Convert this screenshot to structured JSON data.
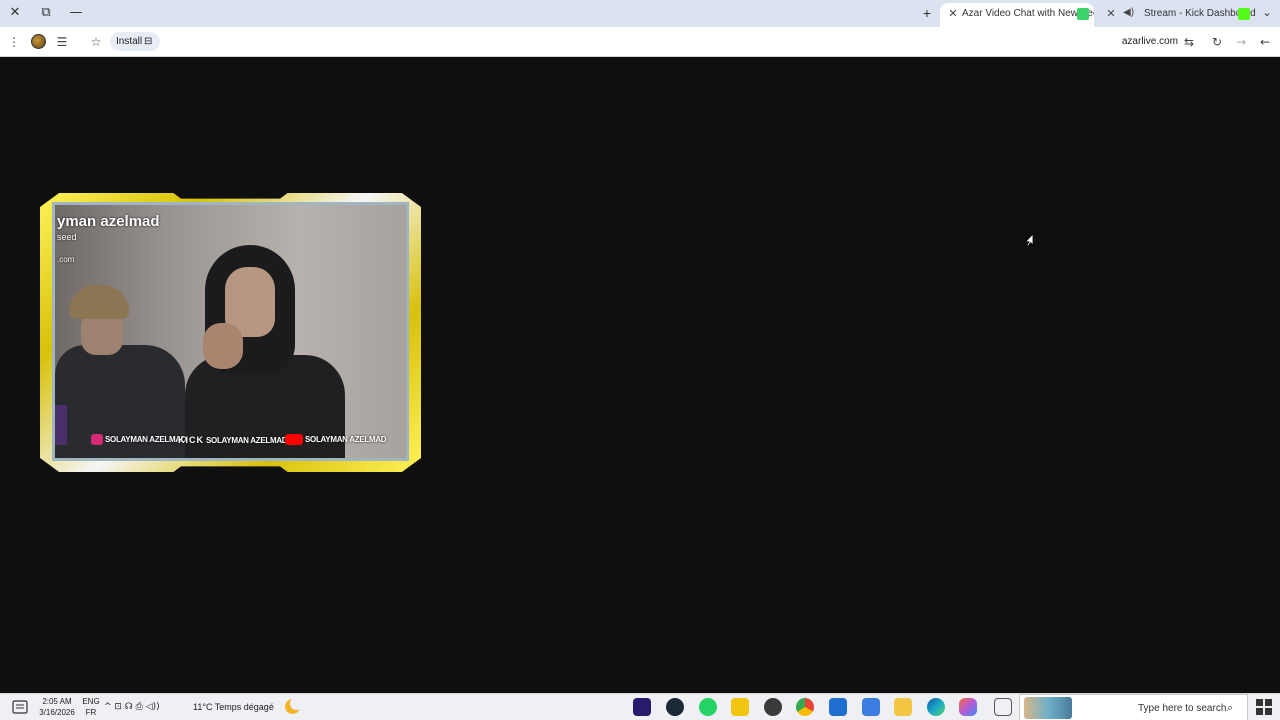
{
  "window": {
    "close_glyph": "✕",
    "restore_glyph": "⧉",
    "minimize_glyph": "—"
  },
  "tabs": {
    "new_tab_glyph": "+",
    "menu_glyph": "⌄",
    "items": [
      {
        "title": "Azar Video Chat with New Peo",
        "close": "✕",
        "favicon_color": "#3ad46b",
        "active": true
      },
      {
        "title": "Stream - Kick Dashboard",
        "close": "✕",
        "favicon_color": "#53fc18",
        "active": false
      }
    ],
    "separator_glyph": "◀)"
  },
  "toolbar": {
    "menu_glyph": "⋮",
    "tab_search_glyph": "☰",
    "bookmark_glyph": "☆",
    "install_label": "Install",
    "install_icon_glyph": "⊟",
    "url": "azarlive.com",
    "site_settings_glyph": "⇆",
    "reload_glyph": "↻",
    "forward_glyph": "→",
    "back_glyph": "←"
  },
  "stream_overlay": {
    "name": "yman azelmad",
    "subtitle": "seed",
    "url_fragment": ".com",
    "socials": [
      {
        "platform": "instagram",
        "handle": "SOLAYMAN AZELMAD",
        "color": "#d62976"
      },
      {
        "platform": "kick",
        "prefix": "KICK",
        "handle": "SOLAYMAN AZELMAD",
        "color": "#53fc18"
      },
      {
        "platform": "youtube",
        "handle": "SOLAYMAN AZELMAD",
        "color": "#ff0000"
      }
    ]
  },
  "taskbar": {
    "search_placeholder": "Type here to search",
    "search_icon_glyph": "⌕",
    "clock_time": "2:05 AM",
    "clock_date": "3/16/2026",
    "lang_top": "ENG",
    "lang_bottom": "FR",
    "weather": "11°C  Temps dégagé",
    "tray_glyphs": "^  ⊡  ☊  ⎙  ◁))",
    "pinned_apps": [
      {
        "name": "premiere-pro",
        "color": "#2a1a6b"
      },
      {
        "name": "steam",
        "color": "#1b2838"
      },
      {
        "name": "whatsapp",
        "color": "#25d366"
      },
      {
        "name": "sticky-notes",
        "color": "#f1c40f"
      },
      {
        "name": "obs",
        "color": "#3a3a3a"
      },
      {
        "name": "chrome",
        "color": "#4285f4"
      },
      {
        "name": "mail",
        "color": "#1f6fd1"
      },
      {
        "name": "store",
        "color": "#3b7de0"
      },
      {
        "name": "file-explorer",
        "color": "#f4c542"
      },
      {
        "name": "edge",
        "color": "#1aa7c7"
      },
      {
        "name": "copilot",
        "color": "#b75ad8"
      },
      {
        "name": "task-view",
        "color": "#555555"
      }
    ]
  }
}
